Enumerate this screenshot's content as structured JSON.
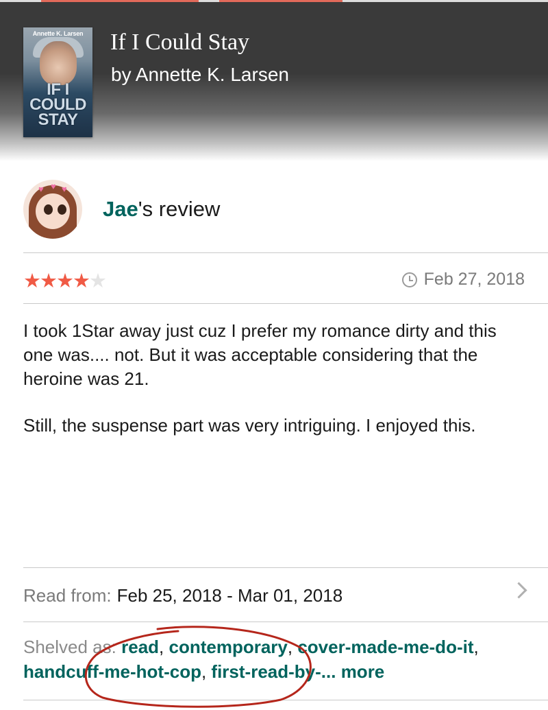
{
  "book": {
    "cover_author": "Annette K. Larsen",
    "cover_title_lines": [
      "IF I",
      "COULD",
      "STAY"
    ],
    "title": "If I Could Stay",
    "byline": "by Annette K. Larsen"
  },
  "review": {
    "reviewer_name": "Jae",
    "title_suffix": "'s review",
    "rating": 4,
    "rating_max": 5,
    "date": "Feb 27, 2018",
    "paragraphs": [
      "I took 1Star away just cuz I prefer my romance dirty and this one was.... not. But it was acceptable considering that the heroine was 21.",
      "Still, the suspense part was very intriguing. I enjoyed this."
    ]
  },
  "read_dates": {
    "label": "Read from:",
    "value": "Feb 25, 2018 - Mar 01, 2018"
  },
  "shelves": {
    "label": "Shelved as:",
    "items": [
      "read",
      "contemporary",
      "cover-made-me-do-it",
      "handcuff-me-hot-cop",
      "first-read-by-..."
    ],
    "more_label": "more"
  },
  "colors": {
    "link": "#00635d",
    "star_on": "#f05a45",
    "star_off": "#e4e4e4",
    "annotation": "#b5261b"
  },
  "icons": {
    "date": "clock-icon",
    "navigate": "chevron-right-icon"
  }
}
